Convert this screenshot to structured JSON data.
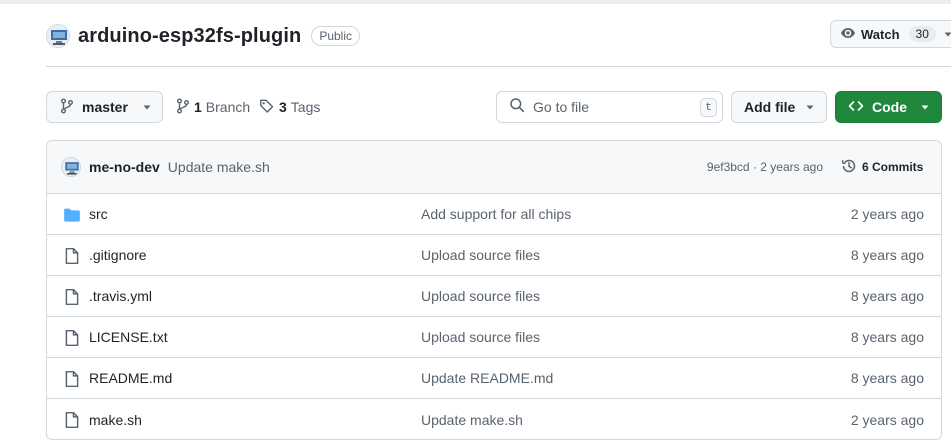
{
  "repo": {
    "name": "arduino-esp32fs-plugin",
    "visibility": "Public",
    "watch_label": "Watch",
    "watch_count": "30"
  },
  "toolbar": {
    "branch_name": "master",
    "branches_count": "1",
    "branches_label": "Branch",
    "tags_count": "3",
    "tags_label": "Tags",
    "search_placeholder": "Go to file",
    "search_shortcut": "t",
    "add_file_label": "Add file",
    "code_label": "Code"
  },
  "latest_commit": {
    "author": "me-no-dev",
    "message": "Update make.sh",
    "sha": "9ef3bcd",
    "separator": " · ",
    "age": "2 years ago",
    "commits_label": "6 Commits"
  },
  "files": [
    {
      "name": "src",
      "type": "folder",
      "message": "Add support for all chips",
      "age": "2 years ago"
    },
    {
      "name": ".gitignore",
      "type": "file",
      "message": "Upload source files",
      "age": "8 years ago"
    },
    {
      "name": ".travis.yml",
      "type": "file",
      "message": "Upload source files",
      "age": "8 years ago"
    },
    {
      "name": "LICENSE.txt",
      "type": "file",
      "message": "Upload source files",
      "age": "8 years ago"
    },
    {
      "name": "README.md",
      "type": "file",
      "message": "Update README.md",
      "age": "8 years ago"
    },
    {
      "name": "make.sh",
      "type": "file",
      "message": "Update make.sh",
      "age": "2 years ago"
    }
  ],
  "colors": {
    "code_button": "#1f883d",
    "folder_icon": "#54aeff",
    "text_muted": "#59636e",
    "border": "#d0d7de"
  },
  "icons": {
    "avatar": "avatar-icon",
    "watch": "eye-icon",
    "branch": "git-branch-icon",
    "tag": "tag-icon",
    "search": "search-icon",
    "code": "code-icon",
    "history": "history-icon",
    "folder": "folder-icon",
    "file": "file-icon",
    "caret": "triangle-down-icon"
  }
}
